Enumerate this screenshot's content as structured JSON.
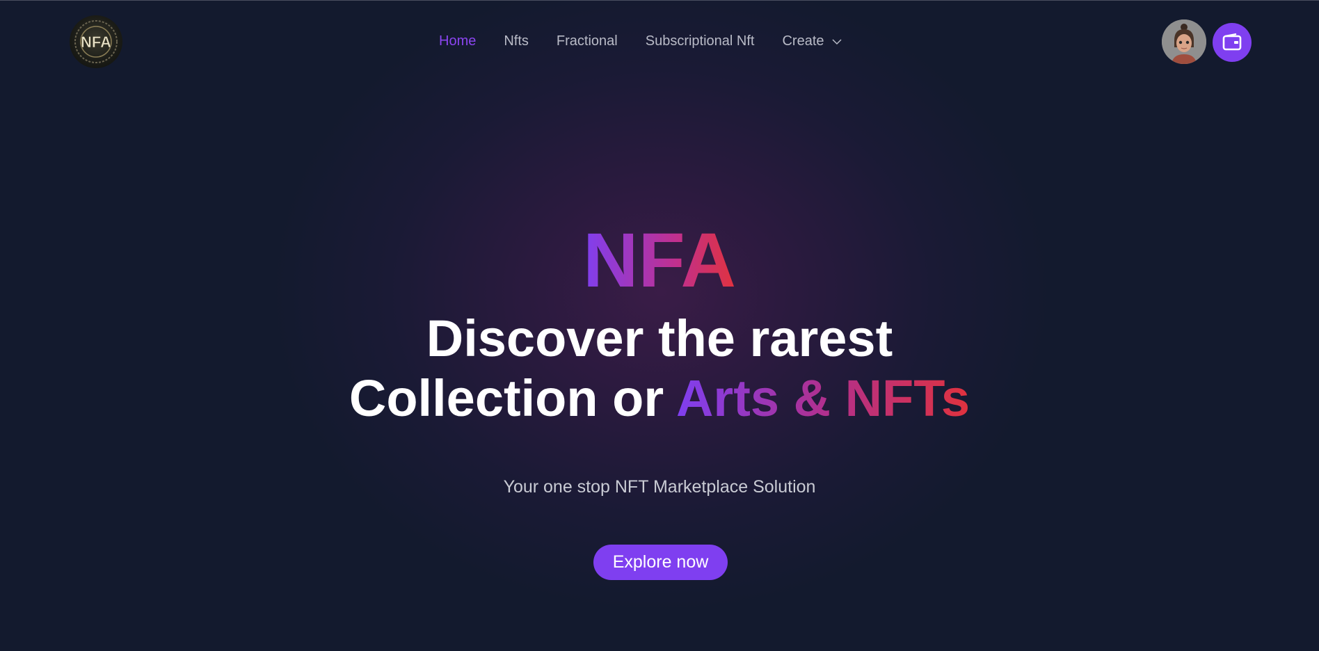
{
  "header": {
    "logo_text": "NFA",
    "nav": {
      "home": "Home",
      "nfts": "Nfts",
      "fractional": "Fractional",
      "subscriptional": "Subscriptional Nft",
      "create": "Create"
    }
  },
  "hero": {
    "brand": "NFA",
    "headline_line1": "Discover the rarest",
    "headline_line2_prefix": "Collection or ",
    "headline_line2_accent": "Arts & NFTs",
    "tagline": "Your one stop NFT Marketplace Solution",
    "cta_label": "Explore now"
  },
  "colors": {
    "accent": "#7f3ff0",
    "accent_red": "#e0323e",
    "active_nav": "#8b45f0",
    "background": "#131a2e"
  },
  "icons": {
    "create_dropdown": "chevron-down-icon",
    "wallet": "wallet-icon",
    "profile": "avatar"
  }
}
